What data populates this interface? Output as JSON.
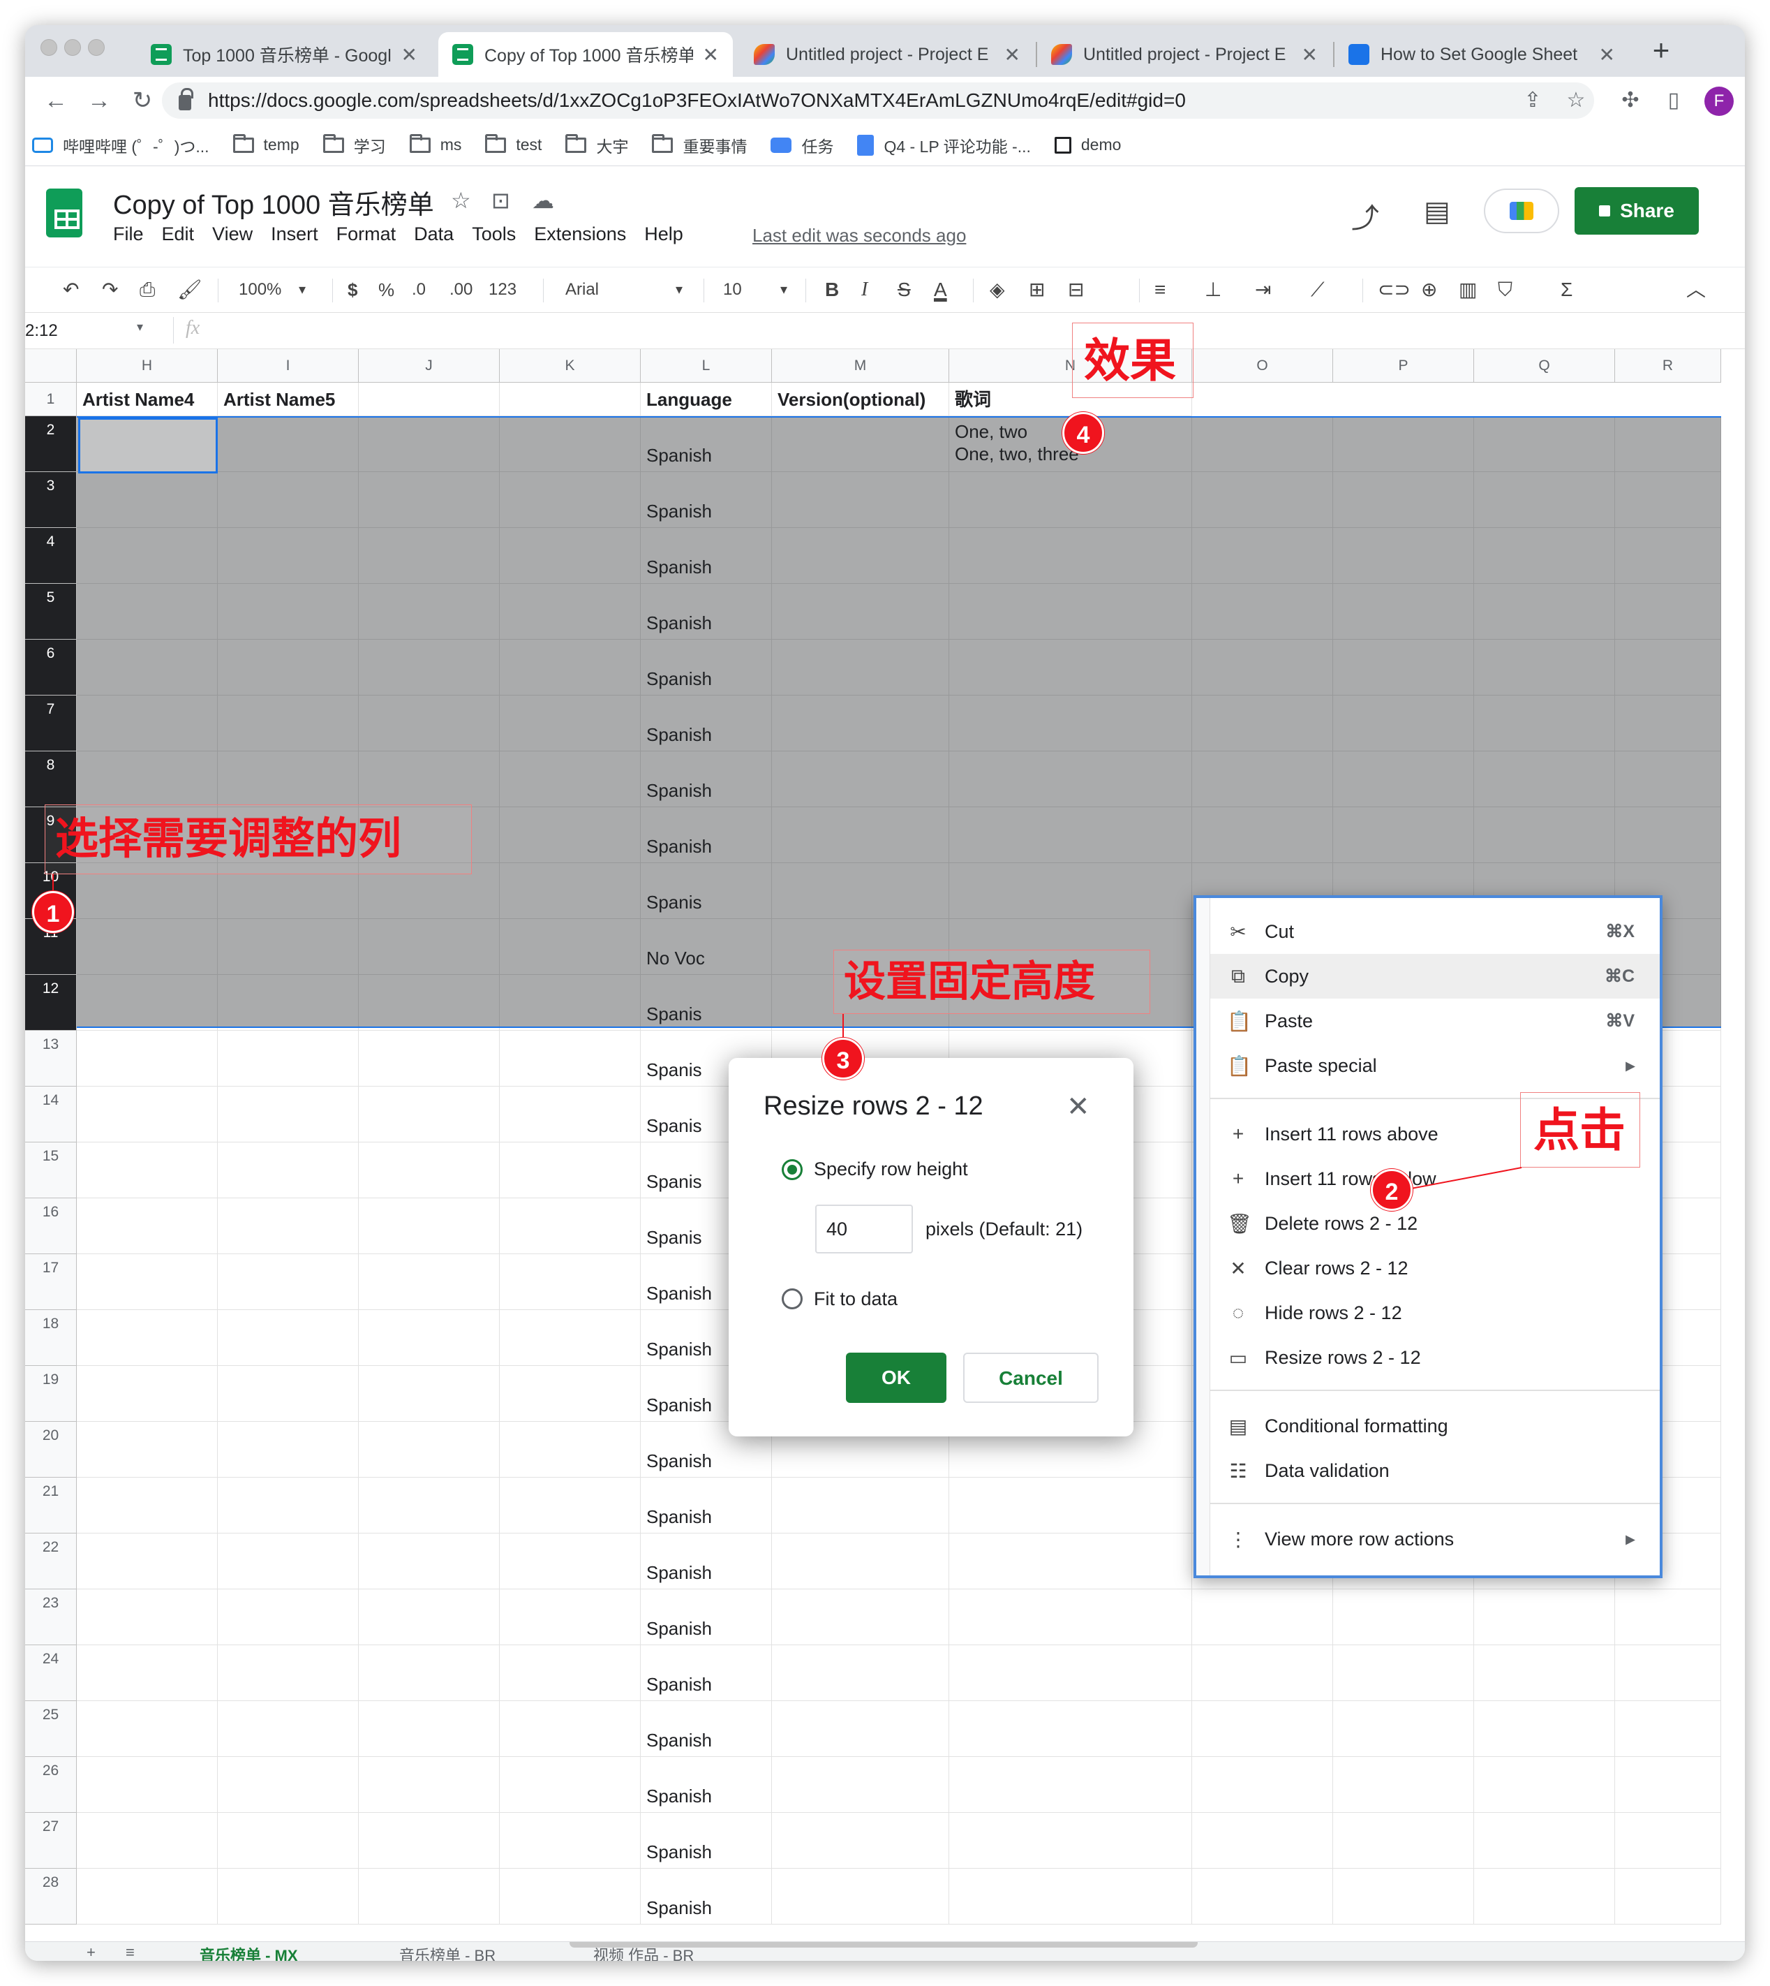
{
  "browser": {
    "tabs": [
      {
        "title": "Top 1000 音乐榜单 - Googl",
        "active": false
      },
      {
        "title": "Copy of Top 1000 音乐榜单",
        "active": true
      },
      {
        "title": "Untitled project - Project E",
        "active": false
      },
      {
        "title": "Untitled project - Project E",
        "active": false
      },
      {
        "title": "How to Set Google Sheet",
        "active": false
      }
    ],
    "close_glyph": "✕",
    "new_tab": "+",
    "url": "https://docs.google.com/spreadsheets/d/1xxZOCg1oP3FEOxIAtWo7ONXaMTX4ErAmLGZNUmo4rqE/edit#gid=0",
    "profile_initial": "F",
    "nav": {
      "back": "←",
      "forward": "→",
      "reload": "↻"
    },
    "bookmarks": [
      {
        "label": "哔哩哔哩 (゜-゜)つ...",
        "icon": "bilibili-icon"
      },
      {
        "label": "temp",
        "icon": "folder-icon"
      },
      {
        "label": "学习",
        "icon": "folder-icon"
      },
      {
        "label": "ms",
        "icon": "folder-icon"
      },
      {
        "label": "test",
        "icon": "folder-icon"
      },
      {
        "label": "大宇",
        "icon": "folder-icon"
      },
      {
        "label": "重要事情",
        "icon": "folder-icon"
      },
      {
        "label": "任务",
        "icon": "task-icon"
      },
      {
        "label": "Q4 - LP 评论功能 -...",
        "icon": "docs-icon"
      },
      {
        "label": "demo",
        "icon": "page-icon"
      }
    ]
  },
  "sheets": {
    "doc_title": "Copy of  Top 1000 音乐榜单",
    "menu": [
      "File",
      "Edit",
      "View",
      "Insert",
      "Format",
      "Data",
      "Tools",
      "Extensions",
      "Help"
    ],
    "last_edit": "Last edit was seconds ago",
    "share_label": "Share",
    "toolbar": {
      "zoom": "100%",
      "currency": "$",
      "percent": "%",
      "dec_less": ".0",
      "dec_more": ".00",
      "format_more": "123",
      "font": "Arial",
      "font_size": "10",
      "bold": "B",
      "italic": "I",
      "strike": "S",
      "text_color": "A"
    },
    "name_box": "2:12",
    "fx": "fx",
    "columns": [
      "H",
      "I",
      "J",
      "K",
      "L",
      "M",
      "N",
      "O",
      "P",
      "Q",
      "R"
    ],
    "header_row": {
      "H": "Artist Name4",
      "I": "Artist Name5",
      "L": "Language",
      "M": "Version(optional)",
      "N": "歌词"
    },
    "lyrics_cell": {
      "line1": "One, two",
      "line2": "One, two, three"
    },
    "rows": [
      {
        "num": "1"
      },
      {
        "num": "2",
        "L": "Spanish"
      },
      {
        "num": "3",
        "L": "Spanish"
      },
      {
        "num": "4",
        "L": "Spanish"
      },
      {
        "num": "5",
        "L": "Spanish"
      },
      {
        "num": "6",
        "L": "Spanish"
      },
      {
        "num": "7",
        "L": "Spanish"
      },
      {
        "num": "8",
        "L": "Spanish"
      },
      {
        "num": "9",
        "L": "Spanish"
      },
      {
        "num": "10",
        "L": "Spanis"
      },
      {
        "num": "11",
        "L": "No Voc"
      },
      {
        "num": "12",
        "L": "Spanis"
      },
      {
        "num": "13",
        "L": "Spanis"
      },
      {
        "num": "14",
        "L": "Spanis"
      },
      {
        "num": "15",
        "L": "Spanis"
      },
      {
        "num": "16",
        "L": "Spanis"
      },
      {
        "num": "17",
        "L": "Spanish"
      },
      {
        "num": "18",
        "L": "Spanish"
      },
      {
        "num": "19",
        "L": "Spanish"
      },
      {
        "num": "20",
        "L": "Spanish"
      },
      {
        "num": "21",
        "L": "Spanish"
      },
      {
        "num": "22",
        "L": "Spanish"
      },
      {
        "num": "23",
        "L": "Spanish"
      },
      {
        "num": "24",
        "L": "Spanish"
      },
      {
        "num": "25",
        "L": "Spanish"
      },
      {
        "num": "26",
        "L": "Spanish"
      },
      {
        "num": "27",
        "L": "Spanish"
      },
      {
        "num": "28",
        "L": "Spanish"
      }
    ],
    "sheet_tabs": [
      "音乐榜单 - MX",
      "音乐榜单 - BR",
      "视频 作品 - BR"
    ]
  },
  "dialog": {
    "title": "Resize rows 2 - 12",
    "close": "✕",
    "option_specify": "Specify row height",
    "height_value": "40",
    "pixels_hint": "pixels (Default: 21)",
    "option_fit": "Fit to data",
    "ok": "OK",
    "cancel": "Cancel"
  },
  "context_menu": {
    "items": [
      {
        "label": "Cut",
        "shortcut": "⌘X",
        "icon": "✂"
      },
      {
        "label": "Copy",
        "shortcut": "⌘C",
        "icon": "⧉"
      },
      {
        "label": "Paste",
        "shortcut": "⌘V",
        "icon": "📋"
      },
      {
        "label": "Paste special",
        "shortcut": "▸",
        "icon": "📋"
      },
      {
        "label": "Insert 11 rows above",
        "shortcut": "",
        "icon": "+"
      },
      {
        "label": "Insert 11 rows below",
        "shortcut": "",
        "icon": "+"
      },
      {
        "label": "Delete rows 2 - 12",
        "shortcut": "",
        "icon": "🗑"
      },
      {
        "label": "Clear rows 2 - 12",
        "shortcut": "",
        "icon": "✕"
      },
      {
        "label": "Hide rows 2 - 12",
        "shortcut": "",
        "icon": "◌"
      },
      {
        "label": "Resize rows 2 - 12",
        "shortcut": "",
        "icon": "▭"
      },
      {
        "label": "Conditional formatting",
        "shortcut": "",
        "icon": "▤"
      },
      {
        "label": "Data validation",
        "shortcut": "",
        "icon": "☷"
      },
      {
        "label": "View more row actions",
        "shortcut": "▸",
        "icon": "⋮"
      }
    ]
  },
  "annotations": {
    "select_rows": "选择需要调整的列",
    "set_height": "设置固定高度",
    "click": "点击",
    "effect": "效果",
    "badges": [
      "1",
      "2",
      "3",
      "4"
    ]
  },
  "colors": {
    "sheets_green": "#188038",
    "annotation_red": "#f0141e",
    "selection_blue": "#1a73e8"
  }
}
